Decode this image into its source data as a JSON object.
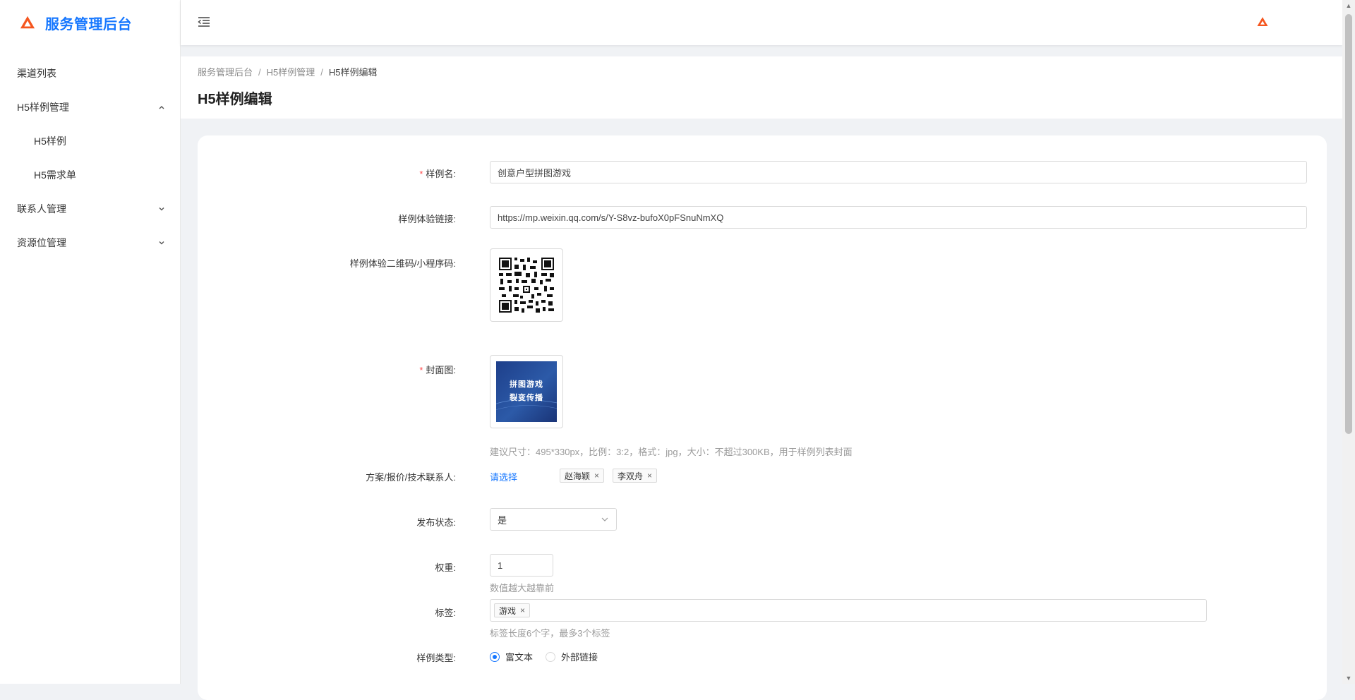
{
  "app": {
    "title": "服务管理后台",
    "accent": "#1677ff",
    "logo_color": "#f5561f"
  },
  "sidebar": {
    "items": [
      {
        "label": "渠道列表"
      },
      {
        "label": "H5样例管理",
        "expanded": true
      },
      {
        "label": "H5样例"
      },
      {
        "label": "H5需求单"
      },
      {
        "label": "联系人管理",
        "expanded": false
      },
      {
        "label": "资源位管理",
        "expanded": false
      }
    ]
  },
  "breadcrumb": [
    "服务管理后台",
    "H5样例管理",
    "H5样例编辑"
  ],
  "page_title": "H5样例编辑",
  "form": {
    "name": {
      "label": "样例名:",
      "value": "创意户型拼图游戏"
    },
    "link": {
      "label": "样例体验链接:",
      "value": "https://mp.weixin.qq.com/s/Y-S8vz-bufoX0pFSnuNmXQ"
    },
    "qrcode": {
      "label": "样例体验二维码/小程序码:",
      "icon": "qr-code"
    },
    "cover": {
      "label": "封面图:",
      "line1": "拼图游戏",
      "line2": "裂变传播",
      "hint": "建议尺寸：495*330px，比例：3:2，格式：jpg，大小：不超过300KB，用于样例列表封面"
    },
    "contacts": {
      "label": "方案/报价/技术联系人:",
      "link": "请选择",
      "tags": [
        "赵海颖",
        "李双舟"
      ]
    },
    "publish": {
      "label": "发布状态:",
      "value": "是"
    },
    "weight": {
      "label": "权重:",
      "value": "1",
      "hint": "数值越大越靠前"
    },
    "tags": {
      "label": "标签:",
      "values": [
        "游戏"
      ],
      "hint": "标签长度6个字，最多3个标签"
    },
    "type": {
      "label": "样例类型:",
      "options": [
        "富文本",
        "外部链接"
      ],
      "selected": "富文本"
    }
  }
}
